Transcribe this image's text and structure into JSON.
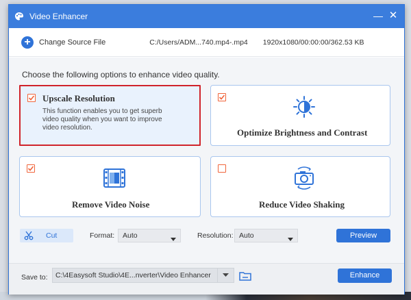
{
  "window": {
    "title": "Video Enhancer",
    "minimize_glyph": "—",
    "close_glyph": "✕",
    "accent_color": "#3b7ddd",
    "icon": "palette-icon"
  },
  "source": {
    "change_label": "Change Source File",
    "file_path": "C:/Users/ADM...740.mp4-.mp4",
    "file_meta": "1920x1080/00:00:00/362.53 KB",
    "icon": "plus-circle-icon"
  },
  "main": {
    "instruction": "Choose the following options to enhance video quality.",
    "options": [
      {
        "title": "Upscale Resolution",
        "description": "This function enables you to get superb video quality when you want to improve video resolution.",
        "checked": true,
        "selected": true
      },
      {
        "title": "Optimize Brightness and Contrast",
        "checked": true,
        "icon": "brightness-icon"
      },
      {
        "title": "Remove Video Noise",
        "checked": true,
        "icon": "film-noise-icon"
      },
      {
        "title": "Reduce Video Shaking",
        "checked": false,
        "icon": "camera-stabilize-icon"
      }
    ]
  },
  "tools": {
    "cut_label": "Cut",
    "format_label": "Format:",
    "format_value": "Auto",
    "resolution_label": "Resolution:",
    "resolution_value": "Auto",
    "preview_label": "Preview"
  },
  "footer": {
    "save_to_label": "Save to:",
    "save_path": "C:\\4Easysoft Studio\\4E...nverter\\Video Enhancer",
    "enhance_label": "Enhance"
  },
  "colors": {
    "primary": "#2f73d8",
    "checkbox": "#f0643a",
    "selection_border": "#d0232a"
  }
}
